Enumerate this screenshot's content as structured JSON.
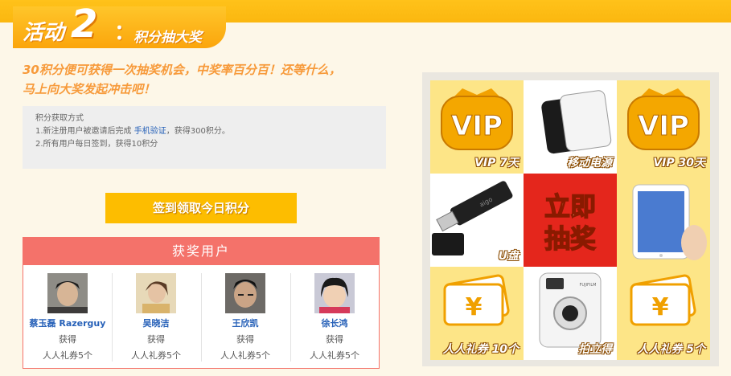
{
  "activity": {
    "title_main": "活动",
    "title_num": "2",
    "title_colon": "：",
    "title_sub": "积分抽大奖",
    "headline_line1": "30积分便可获得一次抽奖机会，中奖率百分百！还等什么，",
    "headline_line2": "马上向大奖发起冲击吧！"
  },
  "info": {
    "heading": "积分获取方式",
    "line1_prefix": "1.新注册用户被邀请后完成 ",
    "line1_link": "手机验证",
    "line1_suffix": "，获得300积分。",
    "line2": "2.所有用户每日签到，获得10积分"
  },
  "sign_button": "签到领取今日积分",
  "winners": {
    "title": "获奖用户",
    "list": [
      {
        "name": "蔡玉磊 Razerguy",
        "action": "获得",
        "prize": "人人礼券5个"
      },
      {
        "name": "吴晓洁",
        "action": "获得",
        "prize": "人人礼券5个"
      },
      {
        "name": "王欣凯",
        "action": "获得",
        "prize": "人人礼券5个"
      },
      {
        "name": "徐长鸿",
        "action": "获得",
        "prize": "人人礼券5个"
      }
    ]
  },
  "prizes": {
    "vip7": "VIP 7天",
    "power": "移动电源",
    "vip30": "VIP 30天",
    "udisk": "U盘",
    "draw_line1": "立即",
    "draw_line2": "抽奖",
    "coupon10": "人人礼券 10个",
    "camera": "拍立得",
    "coupon5": "人人礼券 5个",
    "vip_badge": "VIP",
    "yuan": "¥",
    "usb_brand": "aigo",
    "camera_brand": "FUJIFILM"
  },
  "colors": {
    "accent_orange": "#fba50c",
    "headline": "#f79a3a",
    "button": "#fdbd00",
    "winners_header": "#f4726a",
    "link": "#2761b8",
    "draw_red": "#e4261c"
  }
}
